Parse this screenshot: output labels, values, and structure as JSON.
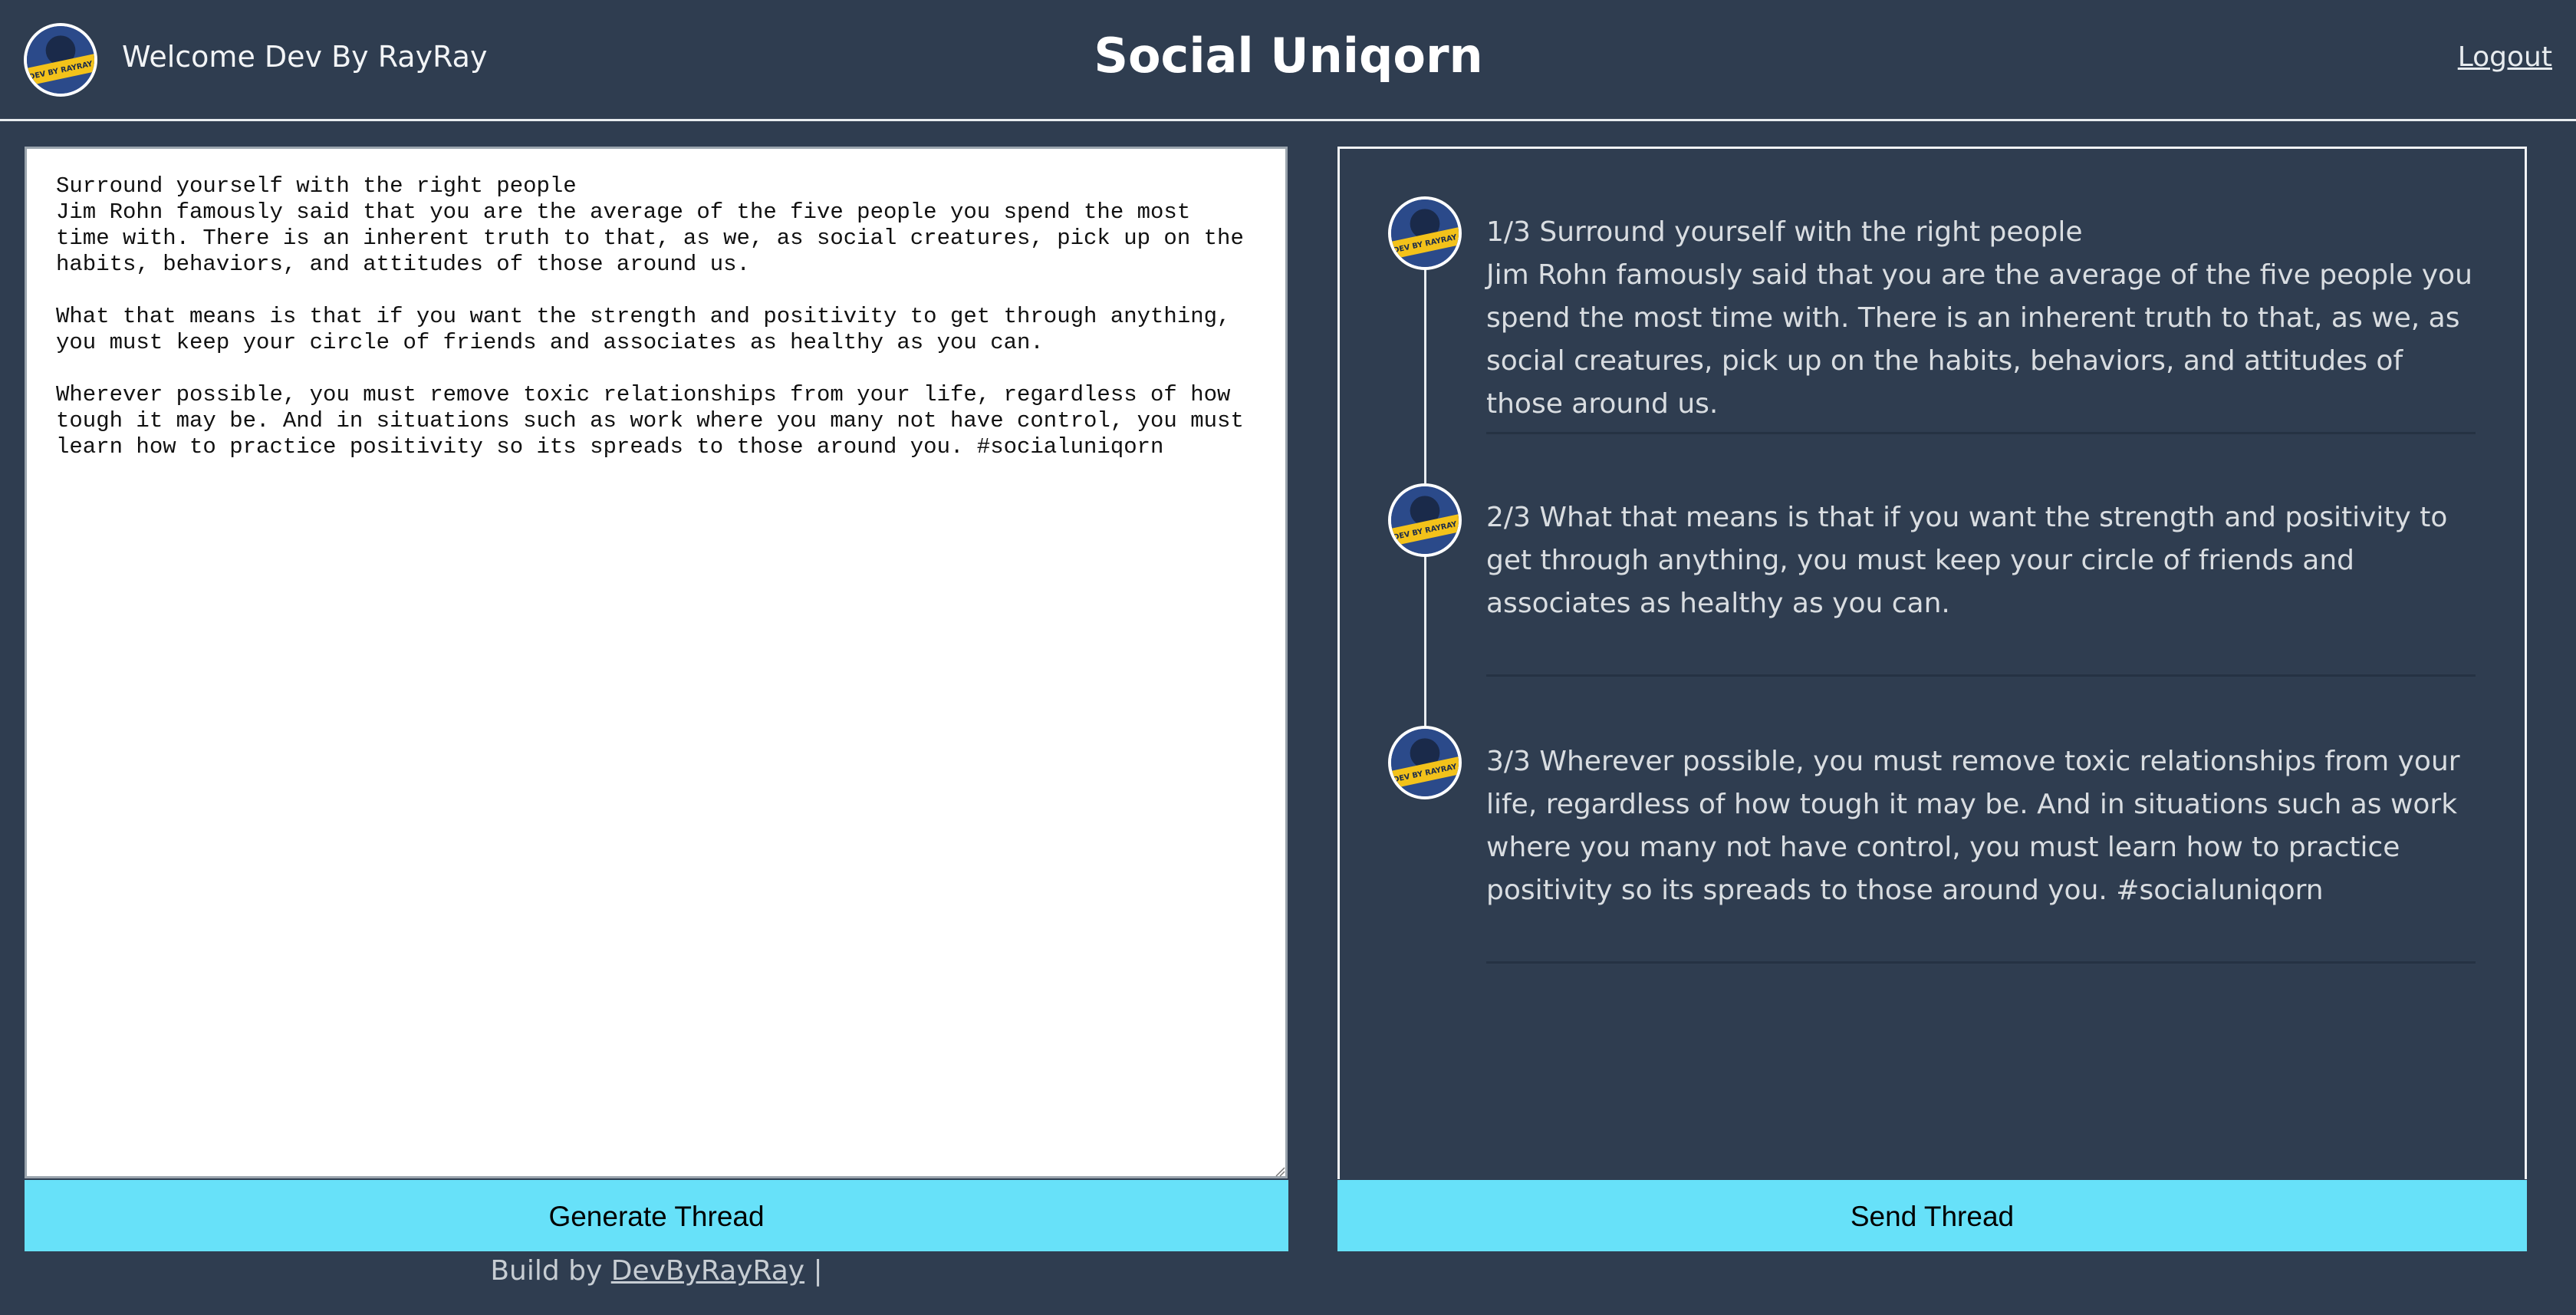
{
  "header": {
    "welcome": "Welcome Dev By RayRay",
    "title": "Social Uniqorn",
    "logout": "Logout"
  },
  "editor": {
    "value": "Surround yourself with the right people\nJim Rohn famously said that you are the average of the five people you spend the most time with. There is an inherent truth to that, as we, as social creatures, pick up on the habits, behaviors, and attitudes of those around us.\n\nWhat that means is that if you want the strength and positivity to get through anything, you must keep your circle of friends and associates as healthy as you can.\n\nWherever possible, you must remove toxic relationships from your life, regardless of how tough it may be. And in situations such as work where you many not have control, you must learn how to practice positivity so its spreads to those around you. #socialuniqorn"
  },
  "thread": [
    {
      "text": "1/3 Surround yourself with the right people\nJim Rohn famously said that you are the average of the five people you spend the most time with. There is an inherent truth to that, as we, as social creatures, pick up on the habits, behaviors, and attitudes of those around us."
    },
    {
      "text": "2/3 What that means is that if you want the strength and positivity to get through anything, you must keep your circle of friends and associates as healthy as you can."
    },
    {
      "text": "3/3 Wherever possible, you must remove toxic relationships from your life, regardless of how tough it may be. And in situations such as work where you many not have control, you must learn how to practice positivity so its spreads to those around you. #socialuniqorn"
    }
  ],
  "buttons": {
    "generate": "Generate Thread",
    "send": "Send Thread"
  },
  "footer": {
    "prefix": "Build by ",
    "link": "DevByRayRay",
    "suffix": " |"
  },
  "avatar": {
    "brand_text": "DEV BY RAYRAY",
    "icon": "avatar-icon"
  },
  "colors": {
    "background": "#2f3d50",
    "button": "#67e1f9"
  }
}
